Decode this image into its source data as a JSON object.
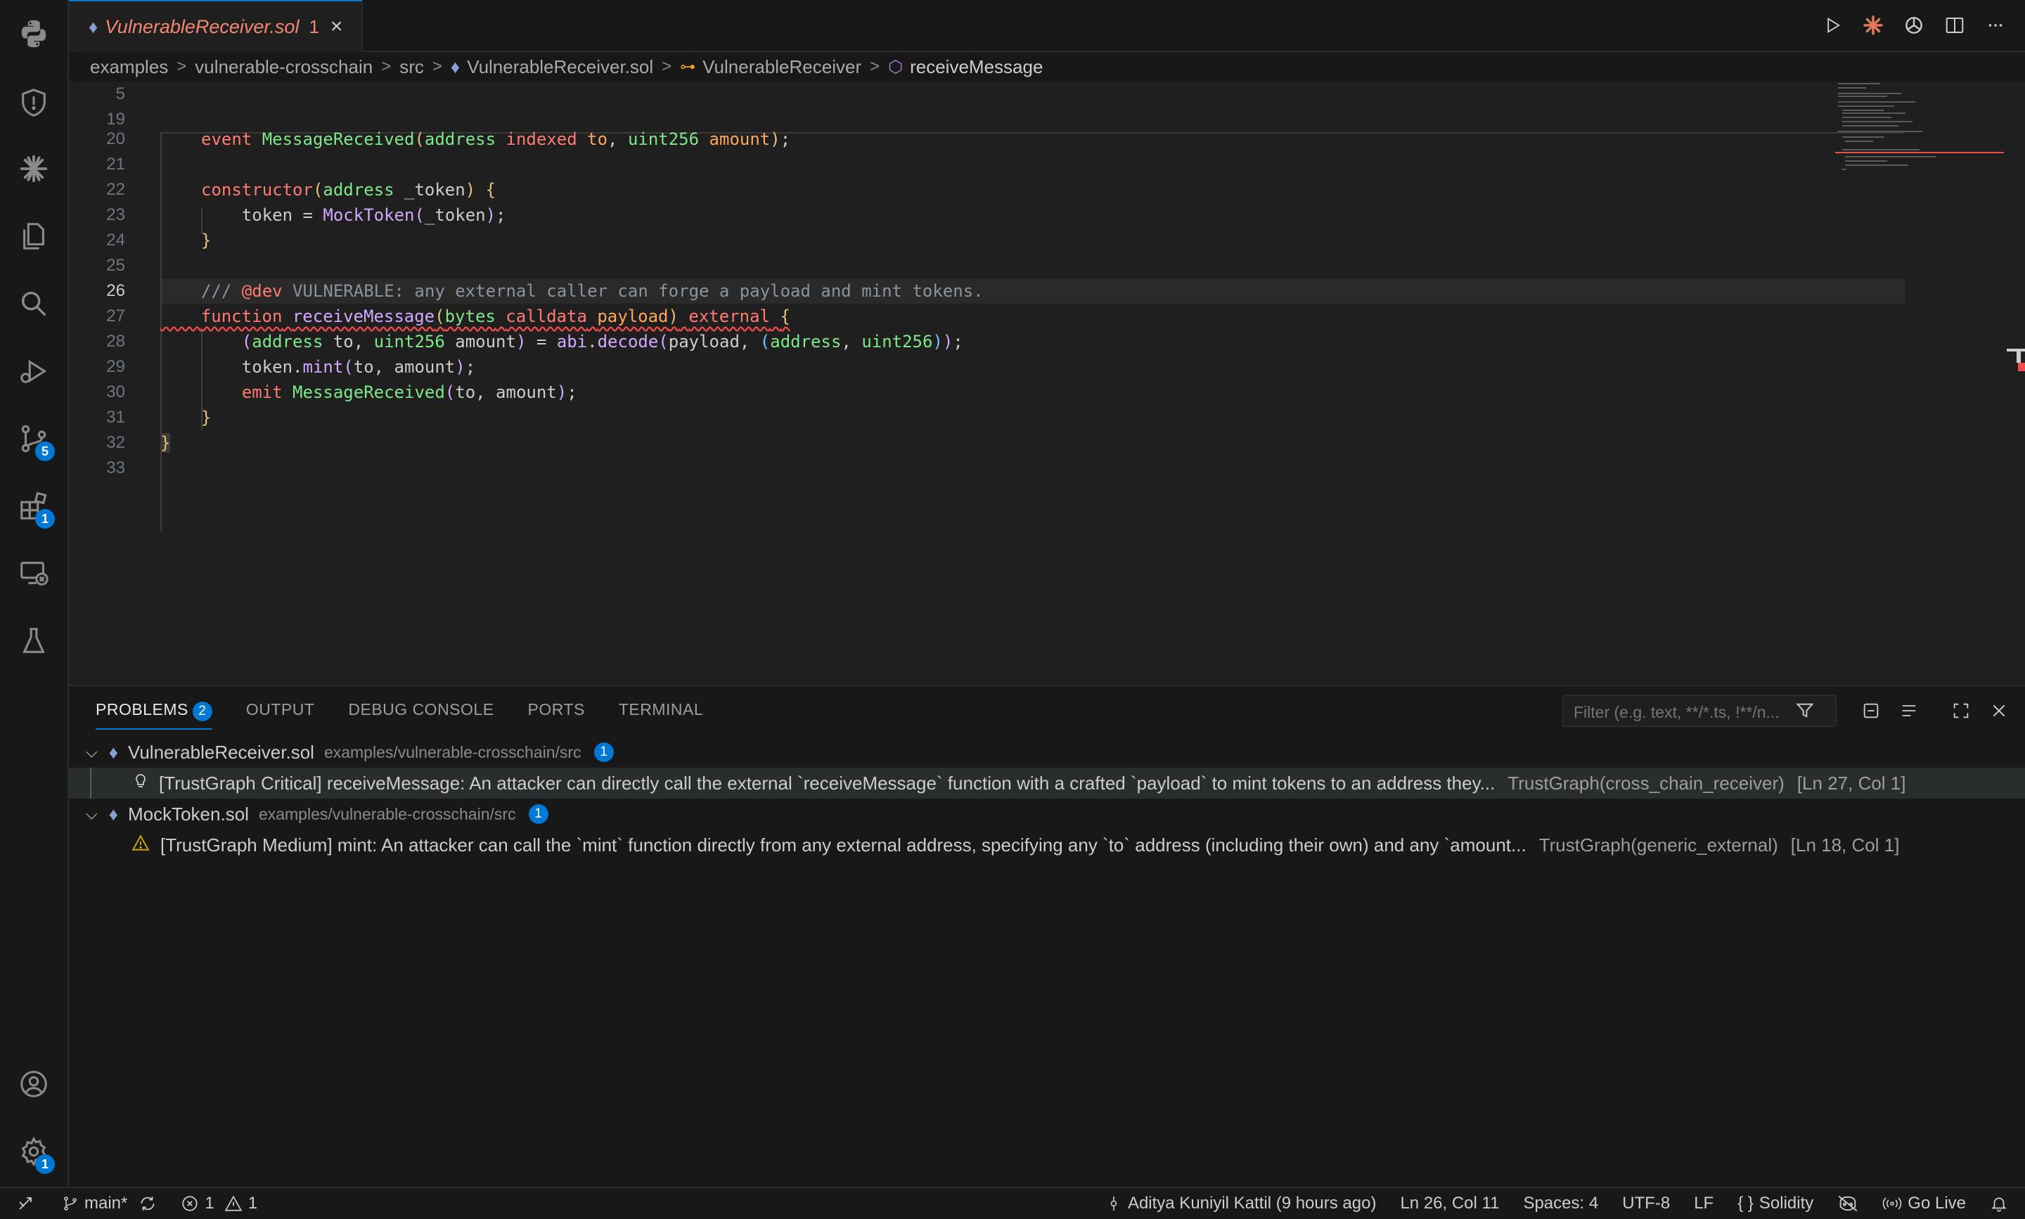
{
  "window": {
    "tab": {
      "filename": "VulnerableReceiver.sol",
      "problem_count": "1",
      "close": "×"
    }
  },
  "breadcrumb": {
    "items": [
      "examples",
      "vulnerable-crosschain",
      "src",
      "VulnerableReceiver.sol",
      "VulnerableReceiver",
      "receiveMessage"
    ],
    "separator": ">"
  },
  "activity_bar": {
    "items": [
      {
        "icon": "python-icon"
      },
      {
        "icon": "shield-icon"
      },
      {
        "icon": "claude-icon"
      },
      {
        "icon": "explorer-icon"
      },
      {
        "icon": "search-icon"
      },
      {
        "icon": "run-debug-icon"
      },
      {
        "icon": "source-control-icon",
        "badge": "5"
      },
      {
        "icon": "extensions-icon",
        "badge": "1"
      },
      {
        "icon": "remote-explorer-icon"
      },
      {
        "icon": "testing-icon"
      }
    ],
    "bottom": [
      {
        "icon": "account-icon"
      },
      {
        "icon": "manage-gear-icon",
        "badge": "1"
      }
    ]
  },
  "editor": {
    "line_numbers": [
      "5",
      "19",
      "20",
      "21",
      "22",
      "23",
      "24",
      "25",
      "26",
      "27",
      "28",
      "29",
      "30",
      "31",
      "32",
      "33"
    ],
    "current_line": "26"
  },
  "panel": {
    "tabs": [
      {
        "label": "PROBLEMS",
        "badge": "2",
        "active": true
      },
      {
        "label": "OUTPUT"
      },
      {
        "label": "DEBUG CONSOLE"
      },
      {
        "label": "PORTS"
      },
      {
        "label": "TERMINAL"
      }
    ],
    "filter_placeholder": "Filter (e.g. text, **/*.ts, !**/n...",
    "groups": [
      {
        "file": "VulnerableReceiver.sol",
        "path": "examples/vulnerable-crosschain/src",
        "count": "1",
        "problem": {
          "message": "[TrustGraph Critical] receiveMessage: An attacker can directly call the external `receiveMessage` function with a crafted `payload` to mint tokens to an address they...",
          "source": "TrustGraph(cross_chain_receiver)",
          "location": "[Ln 27, Col 1]"
        }
      },
      {
        "file": "MockToken.sol",
        "path": "examples/vulnerable-crosschain/src",
        "count": "1",
        "problem": {
          "message": "[TrustGraph Medium] mint: An attacker can call the `mint` function directly from any external address, specifying any `to` address (including their own) and any `amount...",
          "source": "TrustGraph(generic_external)",
          "location": "[Ln 18, Col 1]"
        }
      }
    ]
  },
  "status_bar": {
    "branch": "main*",
    "errors": "1",
    "warnings": "1",
    "blame": "Aditya Kuniyil Kattil (9 hours ago)",
    "cursor": "Ln 26, Col 11",
    "spaces": "Spaces: 4",
    "encoding": "UTF-8",
    "eol": "LF",
    "language_brace": "{ }",
    "language": "Solidity",
    "go_live": "Go Live"
  },
  "colors": {
    "accent": "#0078d4",
    "error": "#f14c4c",
    "warning": "#cca700",
    "tab_modified": "#f48771"
  }
}
